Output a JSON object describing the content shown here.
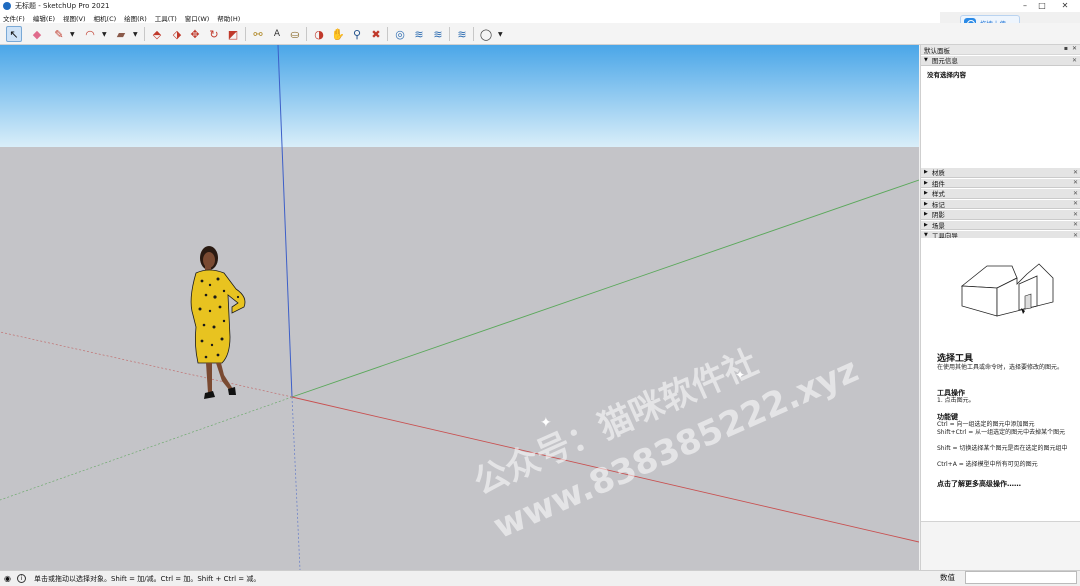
{
  "window": {
    "title": "无标题 - SketchUp Pro 2021",
    "controls": [
      "–",
      "□",
      "✕"
    ]
  },
  "upload": {
    "label": "拖拽上传"
  },
  "menu": [
    "文件(F)",
    "编辑(E)",
    "视图(V)",
    "相机(C)",
    "绘图(R)",
    "工具(T)",
    "窗口(W)",
    "帮助(H)"
  ],
  "toolbar": {
    "tools": [
      {
        "name": "select-tool",
        "glyph": "↖",
        "active": true
      },
      {
        "name": "eraser-tool",
        "glyph": "◆"
      },
      {
        "name": "pencil-tool",
        "glyph": "✎"
      },
      {
        "name": "arc-tool",
        "glyph": "◠"
      },
      {
        "name": "shape-tool",
        "glyph": "▰"
      },
      {
        "name": "push-pull-tool",
        "glyph": "⬘"
      },
      {
        "name": "follow-me-tool",
        "glyph": "⬗"
      },
      {
        "name": "move-tool",
        "glyph": "✥"
      },
      {
        "name": "rotate-tool",
        "glyph": "↻"
      },
      {
        "name": "scale-tool",
        "glyph": "◩"
      },
      {
        "name": "tape-measure-tool",
        "glyph": "⚯"
      },
      {
        "name": "text-tool",
        "glyph": "A"
      },
      {
        "name": "paint-bucket-tool",
        "glyph": "⛀"
      },
      {
        "name": "orbit-tool",
        "glyph": "◑"
      },
      {
        "name": "pan-tool",
        "glyph": "✋"
      },
      {
        "name": "zoom-tool",
        "glyph": "⚲"
      },
      {
        "name": "zoom-extents-tool",
        "glyph": "✖"
      },
      {
        "name": "warehouse-tool",
        "glyph": "◎"
      },
      {
        "name": "extension-warehouse-tool",
        "glyph": "≋"
      },
      {
        "name": "layout-tool",
        "glyph": "≋"
      },
      {
        "name": "extension-manager-tool",
        "glyph": "≋"
      },
      {
        "name": "account-tool",
        "glyph": "◯"
      }
    ]
  },
  "panel": {
    "tray_title": "默认面板",
    "entity_info": "图元信息",
    "entity_empty": "没有选择内容",
    "sections": [
      "材质",
      "组件",
      "样式",
      "标记",
      "阴影",
      "场景",
      "工具向导"
    ],
    "instructor": {
      "title": "选择工具",
      "desc": "在使用其他工具或命令时，选择要修改的图元。",
      "ops_title": "工具操作",
      "ops": "1. 点击图元。",
      "keys_title": "功能键",
      "keys": [
        "Ctrl = 向一组选定的图元中添加图元",
        "Shift+Ctrl = 从一组选定的图元中去掉某个图元",
        "Shift = 切换选择某个图元是否在选定的图元组中",
        "Ctrl+A = 选择模型中所有可见的图元"
      ],
      "more": "点击了解更多高级操作……"
    }
  },
  "watermark": {
    "line1": "公众号：猫咪软件社",
    "line2": "www.838385222.xyz"
  },
  "status": {
    "hint": "单击或拖动以选择对象。Shift = 加/减。Ctrl = 加。Shift + Ctrl = 减。",
    "measure_label": "数值"
  },
  "colors": {
    "sky_top": "#4aa6e8",
    "sky_bottom": "#d7ecf8",
    "ground": "#c4c4c8",
    "axis_red": "#c85050",
    "axis_green": "#5aa85a",
    "axis_blue": "#3d5fc8",
    "figure_dress": "#e8c320"
  }
}
